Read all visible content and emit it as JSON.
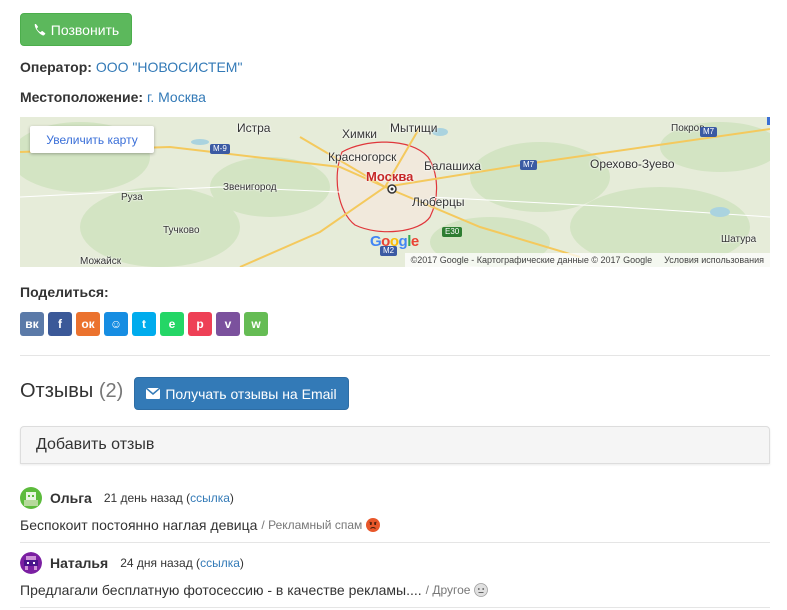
{
  "call_button": {
    "label": "Позвонить",
    "icon": "phone-icon"
  },
  "operator": {
    "label": "Оператор:",
    "value": "ООО \"НОВОСИСТЕМ\""
  },
  "location": {
    "label": "Местоположение:",
    "value": "г. Москва"
  },
  "map": {
    "enlarge_label": "Увеличить карту",
    "places": {
      "istra": "Истра",
      "khimki": "Химки",
      "mytishchi": "Мытищи",
      "pokrov": "Покров",
      "krasnogorsk": "Красногорск",
      "balashikha": "Балашиха",
      "orekhovo": "Орехово-Зуево",
      "moskva": "Москва",
      "zvenigorod": "Звенигород",
      "lyubertsy": "Люберцы",
      "ruza": "Руза",
      "tuchkovo": "Тучково",
      "mozhaysk": "Можайск",
      "shatura": "Шатура"
    },
    "roads": {
      "m9": "M-9",
      "m7a": "M7",
      "m7b": "M7",
      "e30": "E30",
      "m2": "M2"
    },
    "logo": [
      "G",
      "o",
      "o",
      "g",
      "l",
      "e"
    ],
    "copyright": "©2017 Google - Картографические данные © 2017 Google",
    "terms": "Условия использования"
  },
  "share": {
    "title": "Поделиться:",
    "buttons": [
      {
        "name": "vk",
        "glyph": "вк",
        "color": "#5b7aa8"
      },
      {
        "name": "facebook",
        "glyph": "f",
        "color": "#3b5998"
      },
      {
        "name": "odnoklassniki",
        "glyph": "ок",
        "color": "#eb722e"
      },
      {
        "name": "moimir",
        "glyph": "☺",
        "color": "#168de2"
      },
      {
        "name": "twitter",
        "glyph": "t",
        "color": "#00aced"
      },
      {
        "name": "evernote",
        "glyph": "e",
        "color": "#24d666"
      },
      {
        "name": "pocket",
        "glyph": "p",
        "color": "#ee4056"
      },
      {
        "name": "viber",
        "glyph": "v",
        "color": "#7b519d"
      },
      {
        "name": "whatsapp",
        "glyph": "w",
        "color": "#65bc54"
      }
    ]
  },
  "reviews": {
    "title": "Отзывы",
    "count": "(2)",
    "email_button": "Получать отзывы на Email",
    "add_review": "Добавить отзыв",
    "items": [
      {
        "name": "Ольга",
        "time": "21 день назад",
        "link": "ссылка",
        "text": "Беспокоит постоянно наглая девица",
        "tag": "/ Рекламный спам",
        "avatar_color": "#5cbb3c"
      },
      {
        "name": "Наталья",
        "time": "24 дня назад",
        "link": "ссылка",
        "text": "Предлагали бесплатную фотосессию - в качестве рекламы....",
        "tag": "/ Другое",
        "avatar_color": "#7b1fa2"
      }
    ]
  }
}
